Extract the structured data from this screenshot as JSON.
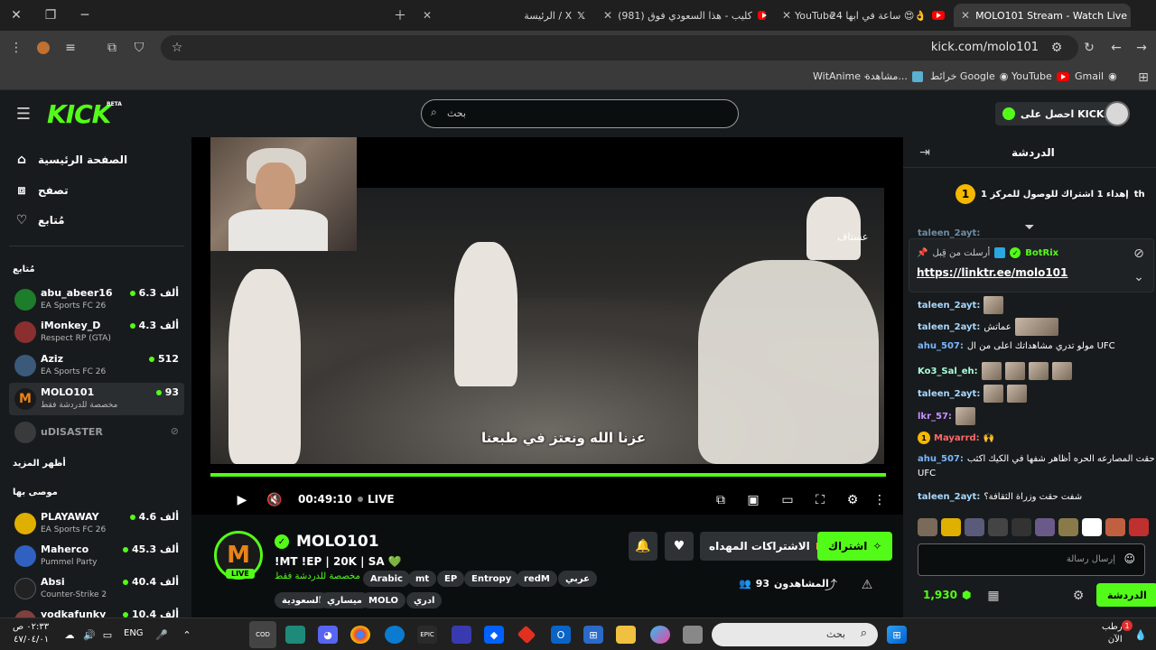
{
  "browser": {
    "tabs": [
      {
        "title": "MOLO101 Stream - Watch Live",
        "active": true
      },
      {
        "title": "24 ساعة في ابها 😍👌"
      },
      {
        "title": "YouTube - "
      },
      {
        "title": "(981) كليب - هذا السعودي فوق"
      },
      {
        "title": "الرئيسة / X"
      }
    ],
    "url": "kick.com/molo101",
    "bookmarks": [
      "Gmail",
      "YouTube",
      "خرائط Google",
      "مشاهدة...",
      "WitAnime - "
    ]
  },
  "header": {
    "logo": "KICK",
    "logo_badge": "BETA",
    "search_placeholder": "بحث",
    "get_kicks": "احصل على KICKs"
  },
  "sidebar": {
    "nav": [
      {
        "label": "الصفحة الرئيسية",
        "icon": "home-icon"
      },
      {
        "label": "تصفح",
        "icon": "browse-icon"
      },
      {
        "label": "مُتابع",
        "icon": "heart-icon"
      }
    ],
    "following_title": "مُتابع",
    "following": [
      {
        "name": "abu_abeer16",
        "category": "EA Sports FC 26",
        "viewers": "6.3 ألف",
        "color": "#1e7d2a"
      },
      {
        "name": "iMonkey_D",
        "category": "Respect RP (GTA)",
        "viewers": "4.3 ألف",
        "color": "#8a2f2f"
      },
      {
        "name": "Aziz",
        "category": "EA Sports FC 26",
        "viewers": "512",
        "color": "#3b5a7a"
      },
      {
        "name": "MOLO101",
        "category": "مخصصة للدردشة فقط",
        "viewers": "93",
        "color": "#e8831a",
        "selected": true
      },
      {
        "name": "uDISASTER",
        "category": "",
        "viewers": "",
        "color": "#555555",
        "offline": true
      }
    ],
    "show_more": "أظهر المزيد",
    "recommended_title": "موصى بها",
    "recommended": [
      {
        "name": "PLAYAWAY",
        "category": "EA Sports FC 26",
        "viewers": "4.6 ألف",
        "color": "#e0b000"
      },
      {
        "name": "Maherco",
        "category": "Pummel Party",
        "viewers": "45.3 ألف",
        "color": "#3060c0"
      },
      {
        "name": "Absi",
        "category": "Counter-Strike 2",
        "viewers": "40.4 ألف",
        "color": "#222222"
      },
      {
        "name": "yodkafunky",
        "category": "",
        "viewers": "10.4 ألف",
        "color": "#804040"
      }
    ]
  },
  "player": {
    "subtitle": "عزنا الله ونعتز في طبعنا",
    "watermark": "عستاف",
    "time": "00:49:10",
    "live_label": "LIVE",
    "progress": 1.0
  },
  "stream": {
    "channel": "MOLO101",
    "live_badge": "LIVE",
    "title": "!MT !EP | 20K | SA 💚",
    "category": "مخصصة للدردشة فقط",
    "tags_row1": [
      "عربي",
      "redM",
      "Entropy",
      "EP",
      "mt",
      "Arabic"
    ],
    "tags_row2": [
      "ادري",
      "MOLO",
      "ميساري",
      "السعودية"
    ],
    "subscribe": "اشتراك",
    "gift": "الاشتراكات المهداه",
    "viewers_label": "المشاهدون",
    "viewers": "93"
  },
  "chat": {
    "title": "الدردشة",
    "goal": "إهداء 1 اشتراك للوصول للمركز 1",
    "goal_suffix": "th",
    "goal_rank": "1",
    "pinned_user": "BotRix",
    "pinned_by": "أرسلت من قِبل",
    "pinned_link": "https://linktr.ee/molo101",
    "messages": [
      {
        "user": "taleen_2ayt:",
        "text": "",
        "color": "#a8d8ff"
      },
      {
        "user": "taleen_2ayt:",
        "text": "عماتش",
        "color": "#a8d8ff"
      },
      {
        "user": "ahu_507:",
        "text": "مولو تدري مشاهداتك اعلى من ال UFC",
        "color": "#7ab8ff"
      },
      {
        "user": "Ko3_Sal_eh:",
        "text": "",
        "color": "#a8ffd8"
      },
      {
        "user": "taleen_2ayt:",
        "text": "",
        "color": "#a8d8ff"
      },
      {
        "user": "lkr_57:",
        "text": "",
        "color": "#c890ff"
      },
      {
        "user": "Mayarrd:",
        "text": "",
        "color": "#ff6868"
      },
      {
        "user": "ahu_507:",
        "text": "حقت المصارعه الحره أظاهر شفها في الكيك اكثب",
        "color": "#7ab8ff"
      },
      {
        "user": "",
        "text": "UFC",
        "color": "#ffffff"
      },
      {
        "user": "taleen_2ayt:",
        "text": "شفت حقت وزراة الثقافة؟",
        "color": "#a8d8ff"
      }
    ],
    "input_placeholder": "إرسال رسالة",
    "points": "1,930",
    "send": "الدردشة"
  },
  "taskbar": {
    "search": "بحث",
    "lang": "ENG",
    "time": "٠٢:٣٣ ص",
    "date": "٤٧/٠٤/٠١",
    "weather_line1": "رطب",
    "weather_line2": "الآن",
    "notif": "1"
  }
}
